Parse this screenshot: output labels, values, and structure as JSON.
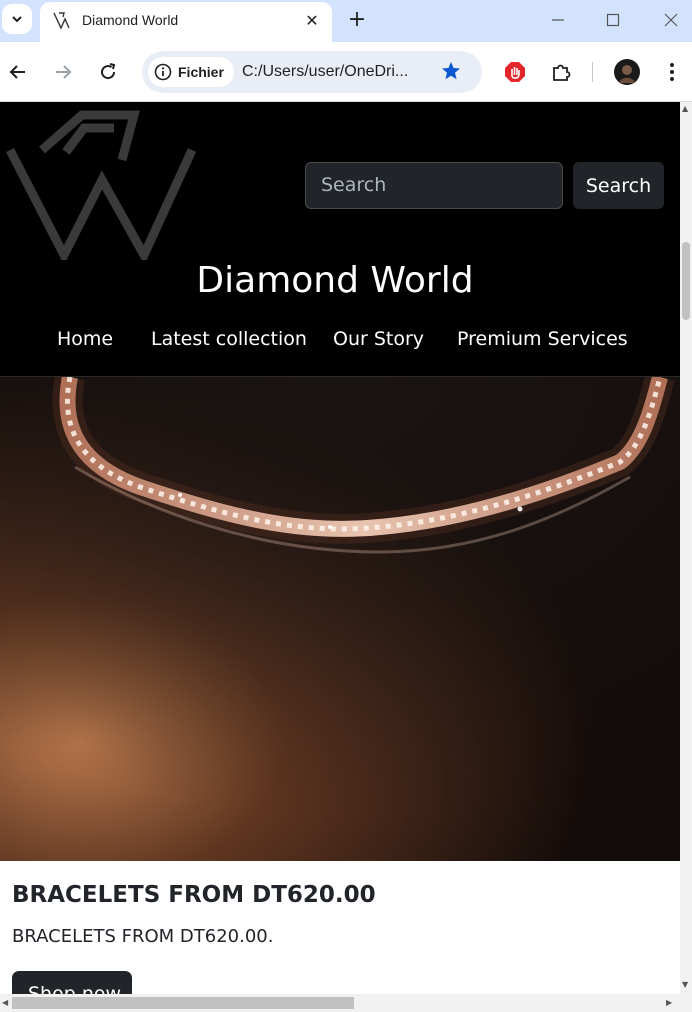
{
  "browser": {
    "tab_title": "Diamond World",
    "site_chip_label": "Fichier",
    "url": "C:/Users/user/OneDri...",
    "accent_color": "#0b57d0"
  },
  "site": {
    "search_placeholder": "Search",
    "search_button": "Search",
    "title": "Diamond World",
    "nav": [
      "Home",
      "Latest collection",
      "Our Story",
      "Premium Services"
    ]
  },
  "hero": {
    "heading": "BRACELETS FROM DT620.00",
    "text": "BRACELETS FROM DT620.00.",
    "button": "Shop now"
  },
  "icons": {
    "tab_menu": "chevron-down-icon",
    "favicon": "diamond-world-logo-icon",
    "close": "close-icon",
    "new_tab": "plus-icon",
    "back": "arrow-left-icon",
    "forward": "arrow-right-icon",
    "reload": "reload-icon",
    "info": "info-icon",
    "star": "star-icon",
    "extension_block": "hand-stop-icon",
    "extensions": "puzzle-icon",
    "menu": "more-vert-icon"
  }
}
